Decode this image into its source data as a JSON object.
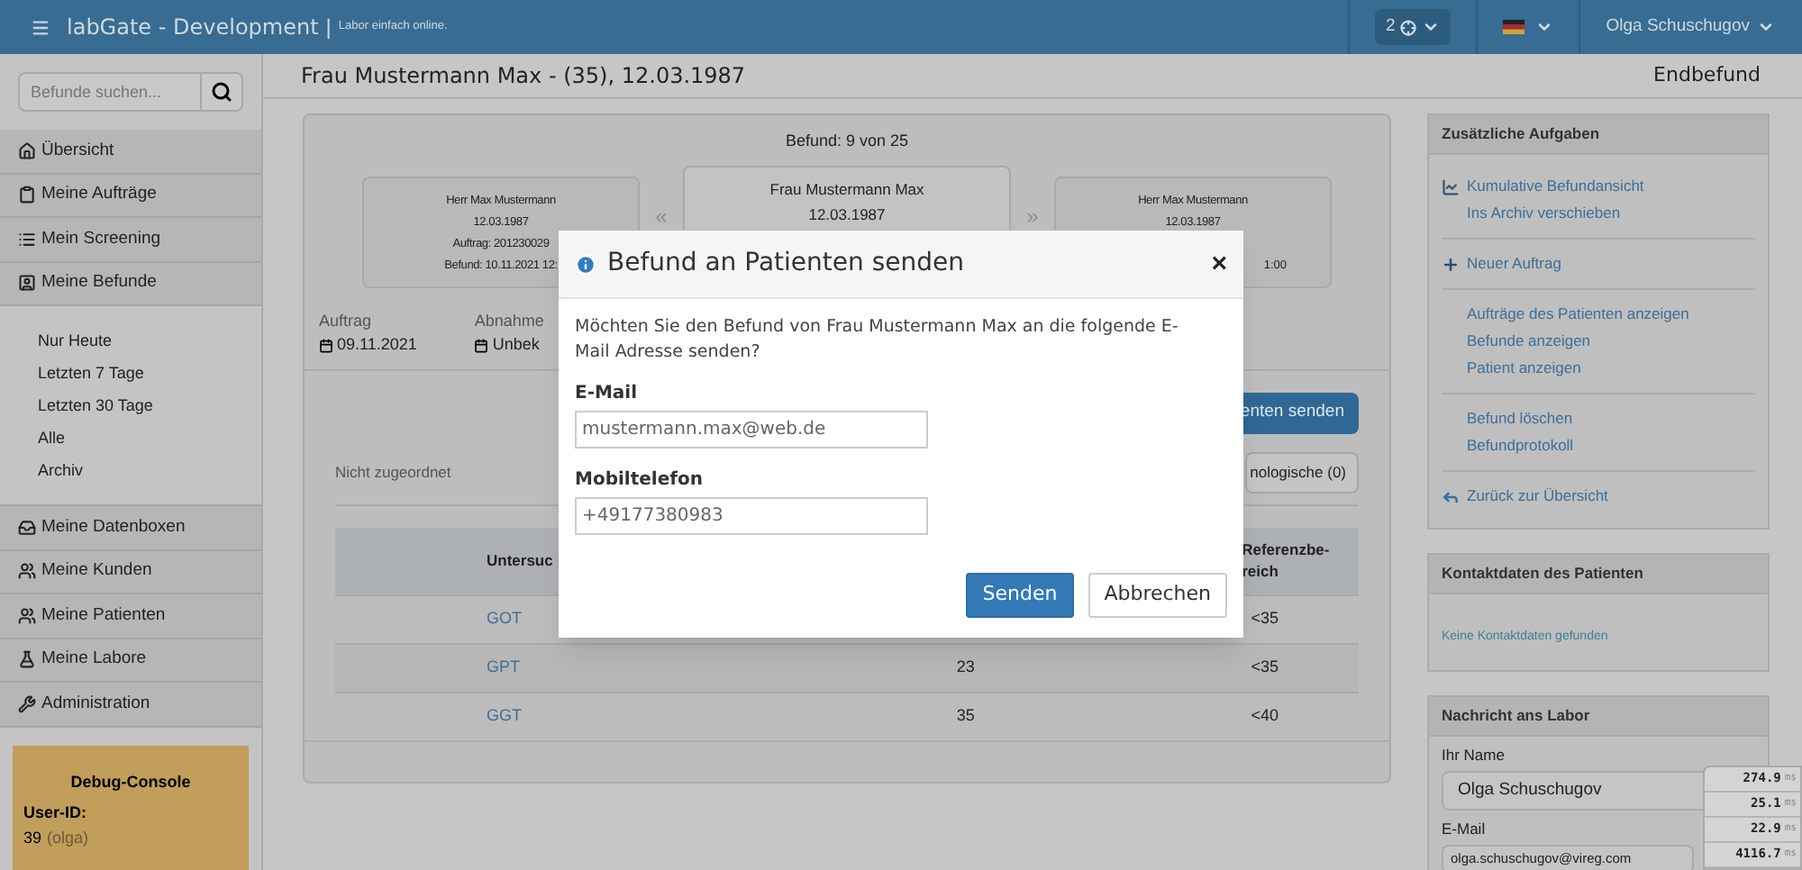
{
  "header": {
    "title": "labGate - Development",
    "separator": "|",
    "tagline": "Labor einfach online.",
    "notifications": "2",
    "user": "Olga Schuschugov"
  },
  "sidebar": {
    "search": {
      "placeholder": "Befunde suchen..."
    },
    "items": [
      {
        "label": "Übersicht",
        "kind": "home"
      },
      {
        "label": "Meine Aufträge",
        "kind": "clipboard"
      },
      {
        "label": "Mein Screening",
        "kind": "list"
      },
      {
        "label": "Meine Befunde",
        "kind": "portrait",
        "children": [
          {
            "label": "Nur Heute"
          },
          {
            "label": "Letzten 7 Tage"
          },
          {
            "label": "Letzten 30 Tage"
          },
          {
            "label": "Alle"
          },
          {
            "label": "Archiv"
          }
        ]
      },
      {
        "label": "Meine Datenboxen",
        "kind": "inbox"
      },
      {
        "label": "Meine Kunden",
        "kind": "users"
      },
      {
        "label": "Meine Patienten",
        "kind": "users"
      },
      {
        "label": "Meine Labore",
        "kind": "flask"
      },
      {
        "label": "Administration",
        "kind": "tools"
      }
    ],
    "debug": {
      "title": "Debug-Console",
      "label": "User-ID:",
      "value": "39",
      "user": "(olga)"
    }
  },
  "page": {
    "title": "Frau Mustermann Max - (35), 12.03.1987",
    "status": "Endbefund"
  },
  "report": {
    "counter": "Befund: 9 von 25",
    "cards": [
      {
        "lines": [
          "Herr Max Mustermann",
          "12.03.1987",
          "Auftrag: 201230029",
          "Befund: 10.11.2021 12:"
        ],
        "selected": false
      },
      {
        "lines": [
          "Frau Mustermann Max",
          "12.03.1987"
        ],
        "selected": true
      },
      {
        "lines": [
          "Herr Max Mustermann",
          "12.03.1987"
        ],
        "cut_line": "1:00",
        "selected": false
      }
    ],
    "prev": "«",
    "next": "»",
    "facts": [
      {
        "label": "Auftrag",
        "value": "09.11.2021"
      },
      {
        "label": "Abnahme",
        "value": "Unbek"
      }
    ],
    "send_button": "enten senden",
    "filter_label": "Nicht zugeordnet",
    "filter_button": "nologische (0)",
    "table": {
      "header": {
        "column_1": "Untersuc",
        "column_3": "Referenzbe-\nreich"
      },
      "rows": [
        {
          "column_1": "GOT",
          "column_3": "<35"
        },
        {
          "column_1": "GPT",
          "column_2": "23",
          "column_3": "<35"
        },
        {
          "column_1": "GGT",
          "column_2": "35",
          "column_3": "<40"
        }
      ]
    }
  },
  "tasks": {
    "title": "Zusätzliche Aufgaben",
    "groups": [
      [
        {
          "label": "Kumulative Befundansicht",
          "kind": "chart"
        },
        {
          "label": "Ins Archiv verschieben",
          "kind": "plain"
        }
      ],
      [
        {
          "label": "Neuer Auftrag",
          "kind": "plus"
        }
      ],
      [
        {
          "label": "Aufträge des Patienten anzeigen",
          "kind": "plain"
        },
        {
          "label": "Befunde anzeigen",
          "kind": "plain"
        },
        {
          "label": "Patient anzeigen",
          "kind": "plain"
        }
      ],
      [
        {
          "label": "Befund löschen",
          "kind": "plain"
        },
        {
          "label": "Befundprotokoll",
          "kind": "plain"
        }
      ],
      [
        {
          "label": "Zurück zur Übersicht",
          "kind": "back"
        }
      ]
    ]
  },
  "contact": {
    "title": "Kontaktdaten des Patienten",
    "text": "Keine Kontaktdaten gefunden"
  },
  "message": {
    "title": "Nachricht ans Labor",
    "name_label": "Ihr Name",
    "name_value": "Olga Schuschugov",
    "email_label": "E-Mail",
    "email_value": "olga.schuschugov@vireg.com"
  },
  "timings": [
    {
      "value": "274.9",
      "unit": "ms"
    },
    {
      "value": "25.1",
      "unit": "ms"
    },
    {
      "value": "22.9",
      "unit": "ms"
    },
    {
      "value": "4116.7",
      "unit": "ms"
    }
  ],
  "modal": {
    "title": "Befund an Patienten senden",
    "close": "×",
    "text": "Möchten Sie den Befund von Frau Mustermann Max an die folgende E-Mail Adresse senden?",
    "email_label": "E-Mail",
    "email_value": "mustermann.max@web.de",
    "phone_label": "Mobiltelefon",
    "phone_value": "+49177380983",
    "buttons": [
      {
        "label": "Senden",
        "kind": "primary"
      },
      {
        "label": "Abbrechen",
        "kind": "default"
      }
    ]
  }
}
